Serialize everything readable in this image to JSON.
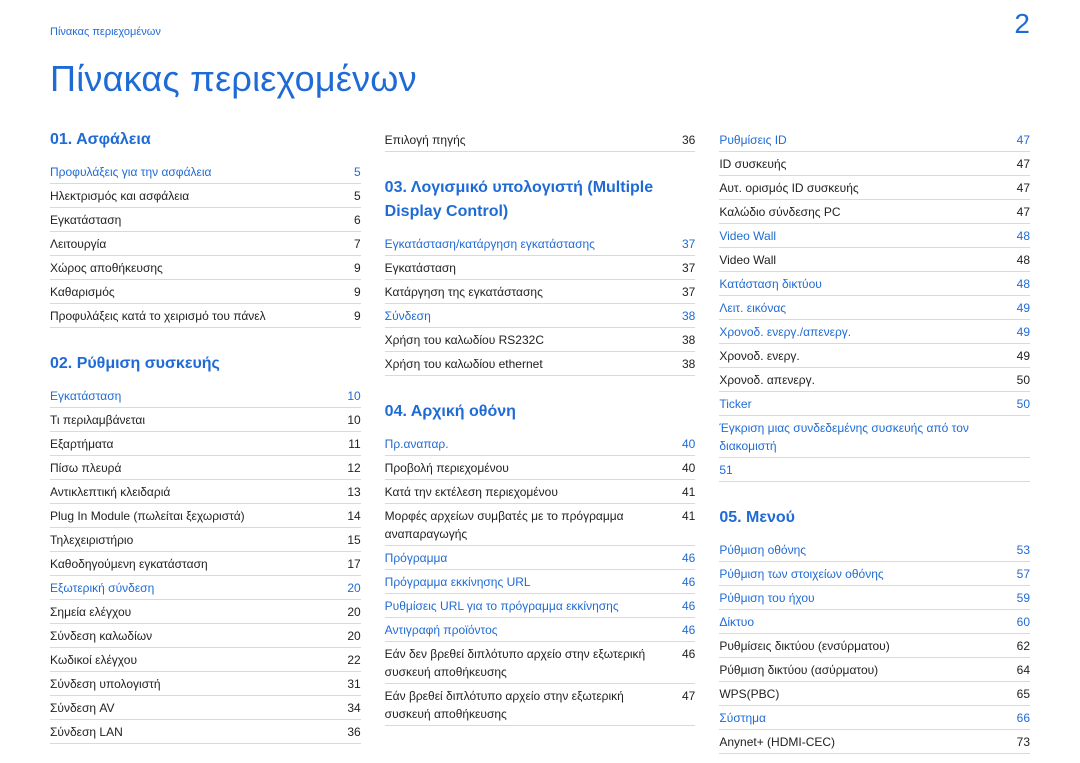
{
  "page_number": "2",
  "header_label": "Πίνακας περιεχομένων",
  "title": "Πίνακας περιεχομένων",
  "columns": [
    [
      {
        "type": "section",
        "label": "01.  Ασφάλεια"
      },
      {
        "type": "link",
        "label": "Προφυλάξεις για την ασφάλεια",
        "page": "5"
      },
      {
        "type": "sub",
        "label": "Ηλεκτρισμός και ασφάλεια",
        "page": "5"
      },
      {
        "type": "sub",
        "label": "Εγκατάσταση",
        "page": "6"
      },
      {
        "type": "sub",
        "label": "Λειτουργία",
        "page": "7"
      },
      {
        "type": "sub",
        "label": "Χώρος αποθήκευσης",
        "page": "9"
      },
      {
        "type": "sub",
        "label": "Καθαρισμός",
        "page": "9"
      },
      {
        "type": "sub",
        "label": "Προφυλάξεις κατά το χειρισμό του πάνελ",
        "page": "9"
      },
      {
        "type": "section_spaced",
        "label": "02.  Ρύθμιση συσκευής"
      },
      {
        "type": "link",
        "label": "Εγκατάσταση",
        "page": "10"
      },
      {
        "type": "sub",
        "label": "Τι περιλαμβάνεται",
        "page": "10"
      },
      {
        "type": "sub",
        "label": "Εξαρτήματα",
        "page": "11"
      },
      {
        "type": "sub",
        "label": "Πίσω πλευρά",
        "page": "12"
      },
      {
        "type": "sub",
        "label": "Αντικλεπτική κλειδαριά",
        "page": "13"
      },
      {
        "type": "sub",
        "label": "Plug In Module (πωλείται ξεχωριστά)",
        "page": "14"
      },
      {
        "type": "sub",
        "label": "Τηλεχειριστήριο",
        "page": "15"
      },
      {
        "type": "sub",
        "label": "Καθοδηγούμενη εγκατάσταση",
        "page": "17"
      },
      {
        "type": "link",
        "label": "Εξωτερική σύνδεση",
        "page": "20"
      },
      {
        "type": "sub",
        "label": "Σημεία ελέγχου",
        "page": "20"
      },
      {
        "type": "sub",
        "label": "Σύνδεση καλωδίων",
        "page": "20"
      },
      {
        "type": "sub",
        "label": "Κωδικοί ελέγχου",
        "page": "22"
      },
      {
        "type": "sub",
        "label": "Σύνδεση υπολογιστή",
        "page": "31"
      },
      {
        "type": "sub",
        "label": "Σύνδεση AV",
        "page": "34"
      },
      {
        "type": "sub",
        "label": "Σύνδεση LAN",
        "page": "36"
      }
    ],
    [
      {
        "type": "sub",
        "label": "Επιλογή πηγής",
        "page": "36"
      },
      {
        "type": "section_spaced",
        "label": "03.  Λογισμικό υπολογιστή (Multiple Display Control)"
      },
      {
        "type": "link",
        "label": "Εγκατάσταση/κατάργηση εγκατάστασης",
        "page": "37"
      },
      {
        "type": "sub",
        "label": "Εγκατάσταση",
        "page": "37"
      },
      {
        "type": "sub",
        "label": "Κατάργηση της εγκατάστασης",
        "page": "37"
      },
      {
        "type": "link",
        "label": "Σύνδεση",
        "page": "38"
      },
      {
        "type": "sub",
        "label": "Χρήση του καλωδίου RS232C",
        "page": "38"
      },
      {
        "type": "sub",
        "label": "Χρήση του καλωδίου ethernet",
        "page": "38"
      },
      {
        "type": "section_spaced",
        "label": "04.  Αρχική οθόνη"
      },
      {
        "type": "link",
        "label": "Πρ.αναπαρ.",
        "page": "40"
      },
      {
        "type": "sub",
        "label": "Προβολή περιεχομένου",
        "page": "40"
      },
      {
        "type": "sub",
        "label": "Κατά την εκτέλεση περιεχομένου",
        "page": "41"
      },
      {
        "type": "sub",
        "label": "Μορφές αρχείων συμβατές με το πρόγραμμα αναπαραγωγής",
        "page": "41"
      },
      {
        "type": "link",
        "label": "Πρόγραμμα",
        "page": "46"
      },
      {
        "type": "link",
        "label": "Πρόγραμμα εκκίνησης URL",
        "page": "46"
      },
      {
        "type": "link",
        "label": "Ρυθμίσεις URL για το πρόγραμμα εκκίνησης",
        "page": "46"
      },
      {
        "type": "link",
        "label": "Αντιγραφή προϊόντος",
        "page": "46"
      },
      {
        "type": "sub",
        "label": "Εάν δεν βρεθεί διπλότυπο αρχείο στην εξωτερική συσκευή αποθήκευσης",
        "page": "46"
      },
      {
        "type": "sub",
        "label": "Εάν βρεθεί διπλότυπο αρχείο στην εξωτερική συσκευή αποθήκευσης",
        "page": "47"
      }
    ],
    [
      {
        "type": "link",
        "label": "Ρυθμίσεις ID",
        "page": "47"
      },
      {
        "type": "sub",
        "label": "ID συσκευής",
        "page": "47"
      },
      {
        "type": "sub",
        "label": "Αυτ. ορισμός ID συσκευής",
        "page": "47"
      },
      {
        "type": "sub",
        "label": "Καλώδιο σύνδεσης PC",
        "page": "47"
      },
      {
        "type": "link",
        "label": "Video Wall",
        "page": "48"
      },
      {
        "type": "sub",
        "label": "Video Wall",
        "page": "48"
      },
      {
        "type": "link",
        "label": "Κατάσταση δικτύου",
        "page": "48"
      },
      {
        "type": "link",
        "label": "Λειτ. εικόνας",
        "page": "49"
      },
      {
        "type": "link",
        "label": "Χρονοδ. ενεργ./απενεργ.",
        "page": "49"
      },
      {
        "type": "sub",
        "label": "Χρονοδ. ενεργ.",
        "page": "49"
      },
      {
        "type": "sub",
        "label": "Χρονοδ. απενεργ.",
        "page": "50"
      },
      {
        "type": "link",
        "label": "Ticker",
        "page": "50"
      },
      {
        "type": "link",
        "label": "Έγκριση μιας συνδεδεμένης συσκευής από τον διακομιστή",
        "page": ""
      },
      {
        "type": "link",
        "label": "51",
        "page": ""
      },
      {
        "type": "section_spaced",
        "label": "05.  Μενού"
      },
      {
        "type": "link",
        "label": "Ρύθμιση οθόνης",
        "page": "53"
      },
      {
        "type": "link",
        "label": "Ρύθμιση των στοιχείων οθόνης",
        "page": "57"
      },
      {
        "type": "link",
        "label": "Ρύθμιση του ήχου",
        "page": "59"
      },
      {
        "type": "link",
        "label": "Δίκτυο",
        "page": "60"
      },
      {
        "type": "sub",
        "label": "Ρυθμίσεις δικτύου (ενσύρματου)",
        "page": "62"
      },
      {
        "type": "sub",
        "label": "Ρύθμιση δικτύου (ασύρματου)",
        "page": "64"
      },
      {
        "type": "sub",
        "label": "WPS(PBC)",
        "page": "65"
      },
      {
        "type": "link",
        "label": "Σύστημα",
        "page": "66"
      },
      {
        "type": "sub",
        "label": "Anynet+ (HDMI-CEC)",
        "page": "73"
      }
    ]
  ]
}
